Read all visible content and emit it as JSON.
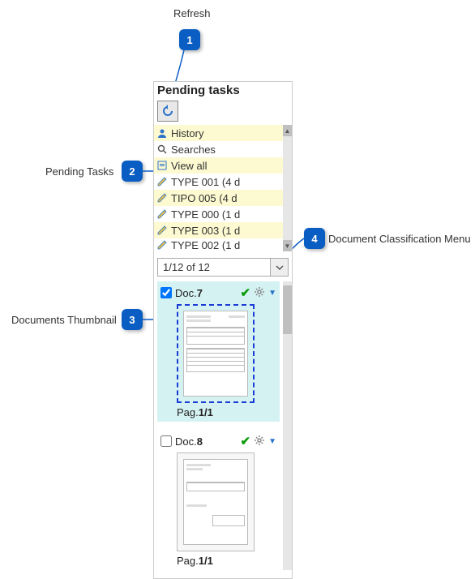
{
  "annotations": {
    "refresh": "Refresh",
    "pending_tasks": "Pending Tasks",
    "documents_thumbnail": "Documents Thumbnail",
    "doc_class_menu": "Document Classification Menu",
    "n1": "1",
    "n2": "2",
    "n3": "3",
    "n4": "4"
  },
  "panel": {
    "title": "Pending tasks",
    "rows": {
      "history": "History",
      "searches": "Searches",
      "view_all": "View all",
      "t1": "TYPE 001 (4 d",
      "t2": "TIPO 005 (4 d",
      "t3": "TYPE 000 (1 d",
      "t4": "TYPE 003 (1 d",
      "t5": "TYPE 002 (1 d"
    },
    "nav": "1/12 of 12"
  },
  "docs": {
    "d7": {
      "label_prefix": "Doc.",
      "num": "7",
      "page_prefix": "Pag.",
      "page": "1/1"
    },
    "d8": {
      "label_prefix": "Doc.",
      "num": "8",
      "page_prefix": "Pag.",
      "page": "1/1"
    }
  }
}
